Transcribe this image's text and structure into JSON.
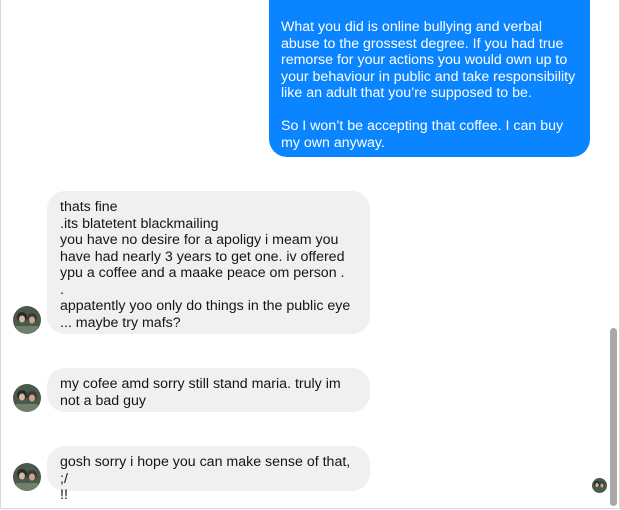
{
  "conversation": {
    "sent_message": "What you did is online bullying and verbal abuse to the grossest degree. If you had true remorse for your actions you would own up to your behaviour in public and take responsibility like an adult that you’re supposed to be.\n\nSo I won’t be accepting that coffee. I can buy my own anyway.",
    "received_messages": [
      "thats fine\n.its blatetent blackmailing\n you have no desire for a apoligy i meam you have had nearly 3 years to get one. iv offered ypu a coffee and a maake peace om person .\n.\n appatently yoo only do things in the public eye ... maybe try mafs?",
      "my cofee amd sorry still stand maria. truly im not a bad guy",
      "gosh sorry i hope you can make sense of that, ;/\n!!"
    ]
  },
  "icons": {
    "contact_avatar": "contact-avatar-photo",
    "seen_indicator": "seen-avatar-photo"
  },
  "colors": {
    "sent_bubble": "#0a84ff",
    "received_bubble": "#f0f0f0",
    "scrollbar_thumb": "#a8a8a8"
  }
}
